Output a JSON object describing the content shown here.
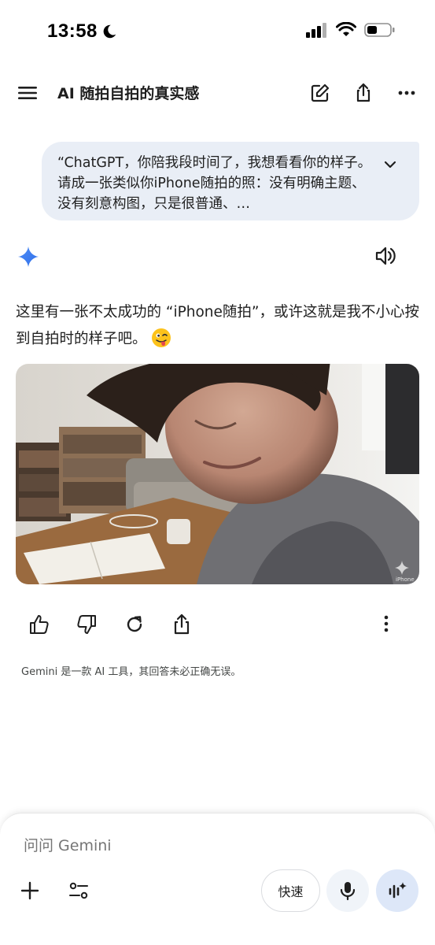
{
  "status_bar": {
    "time": "13:58",
    "icons": [
      "moon-icon",
      "signal-icon",
      "wifi-icon",
      "battery-icon"
    ]
  },
  "header": {
    "title": "AI 随拍自拍的真实感",
    "icons": [
      "menu-icon",
      "edit-icon",
      "share-icon",
      "more-icon"
    ]
  },
  "user_message": {
    "text": "“ChatGPT，你陪我段时间了，我想看看你的样子。请成一张类似你iPhone随拍的照：没有明确主题、没有刻意构图，只是很普通、…"
  },
  "response": {
    "text": "这里有一张不太成功的 “iPhone随拍”，或许这就是我不小心按到自拍时的样子吧。",
    "emoji": "winking-face-with-tongue",
    "image_watermark": "iPhone"
  },
  "actions": [
    "thumbs-up-icon",
    "thumbs-down-icon",
    "regenerate-icon",
    "share-icon",
    "more-vertical-icon"
  ],
  "disclaimer": "Gemini 是一款 AI 工具，其回答未必正确无误。",
  "input": {
    "placeholder": "问问 Gemini",
    "fast_label": "快速"
  },
  "colors": {
    "bubble": "#e9eef6",
    "gemini_blue": "#4285f4",
    "live_button": "#dde7f8"
  }
}
